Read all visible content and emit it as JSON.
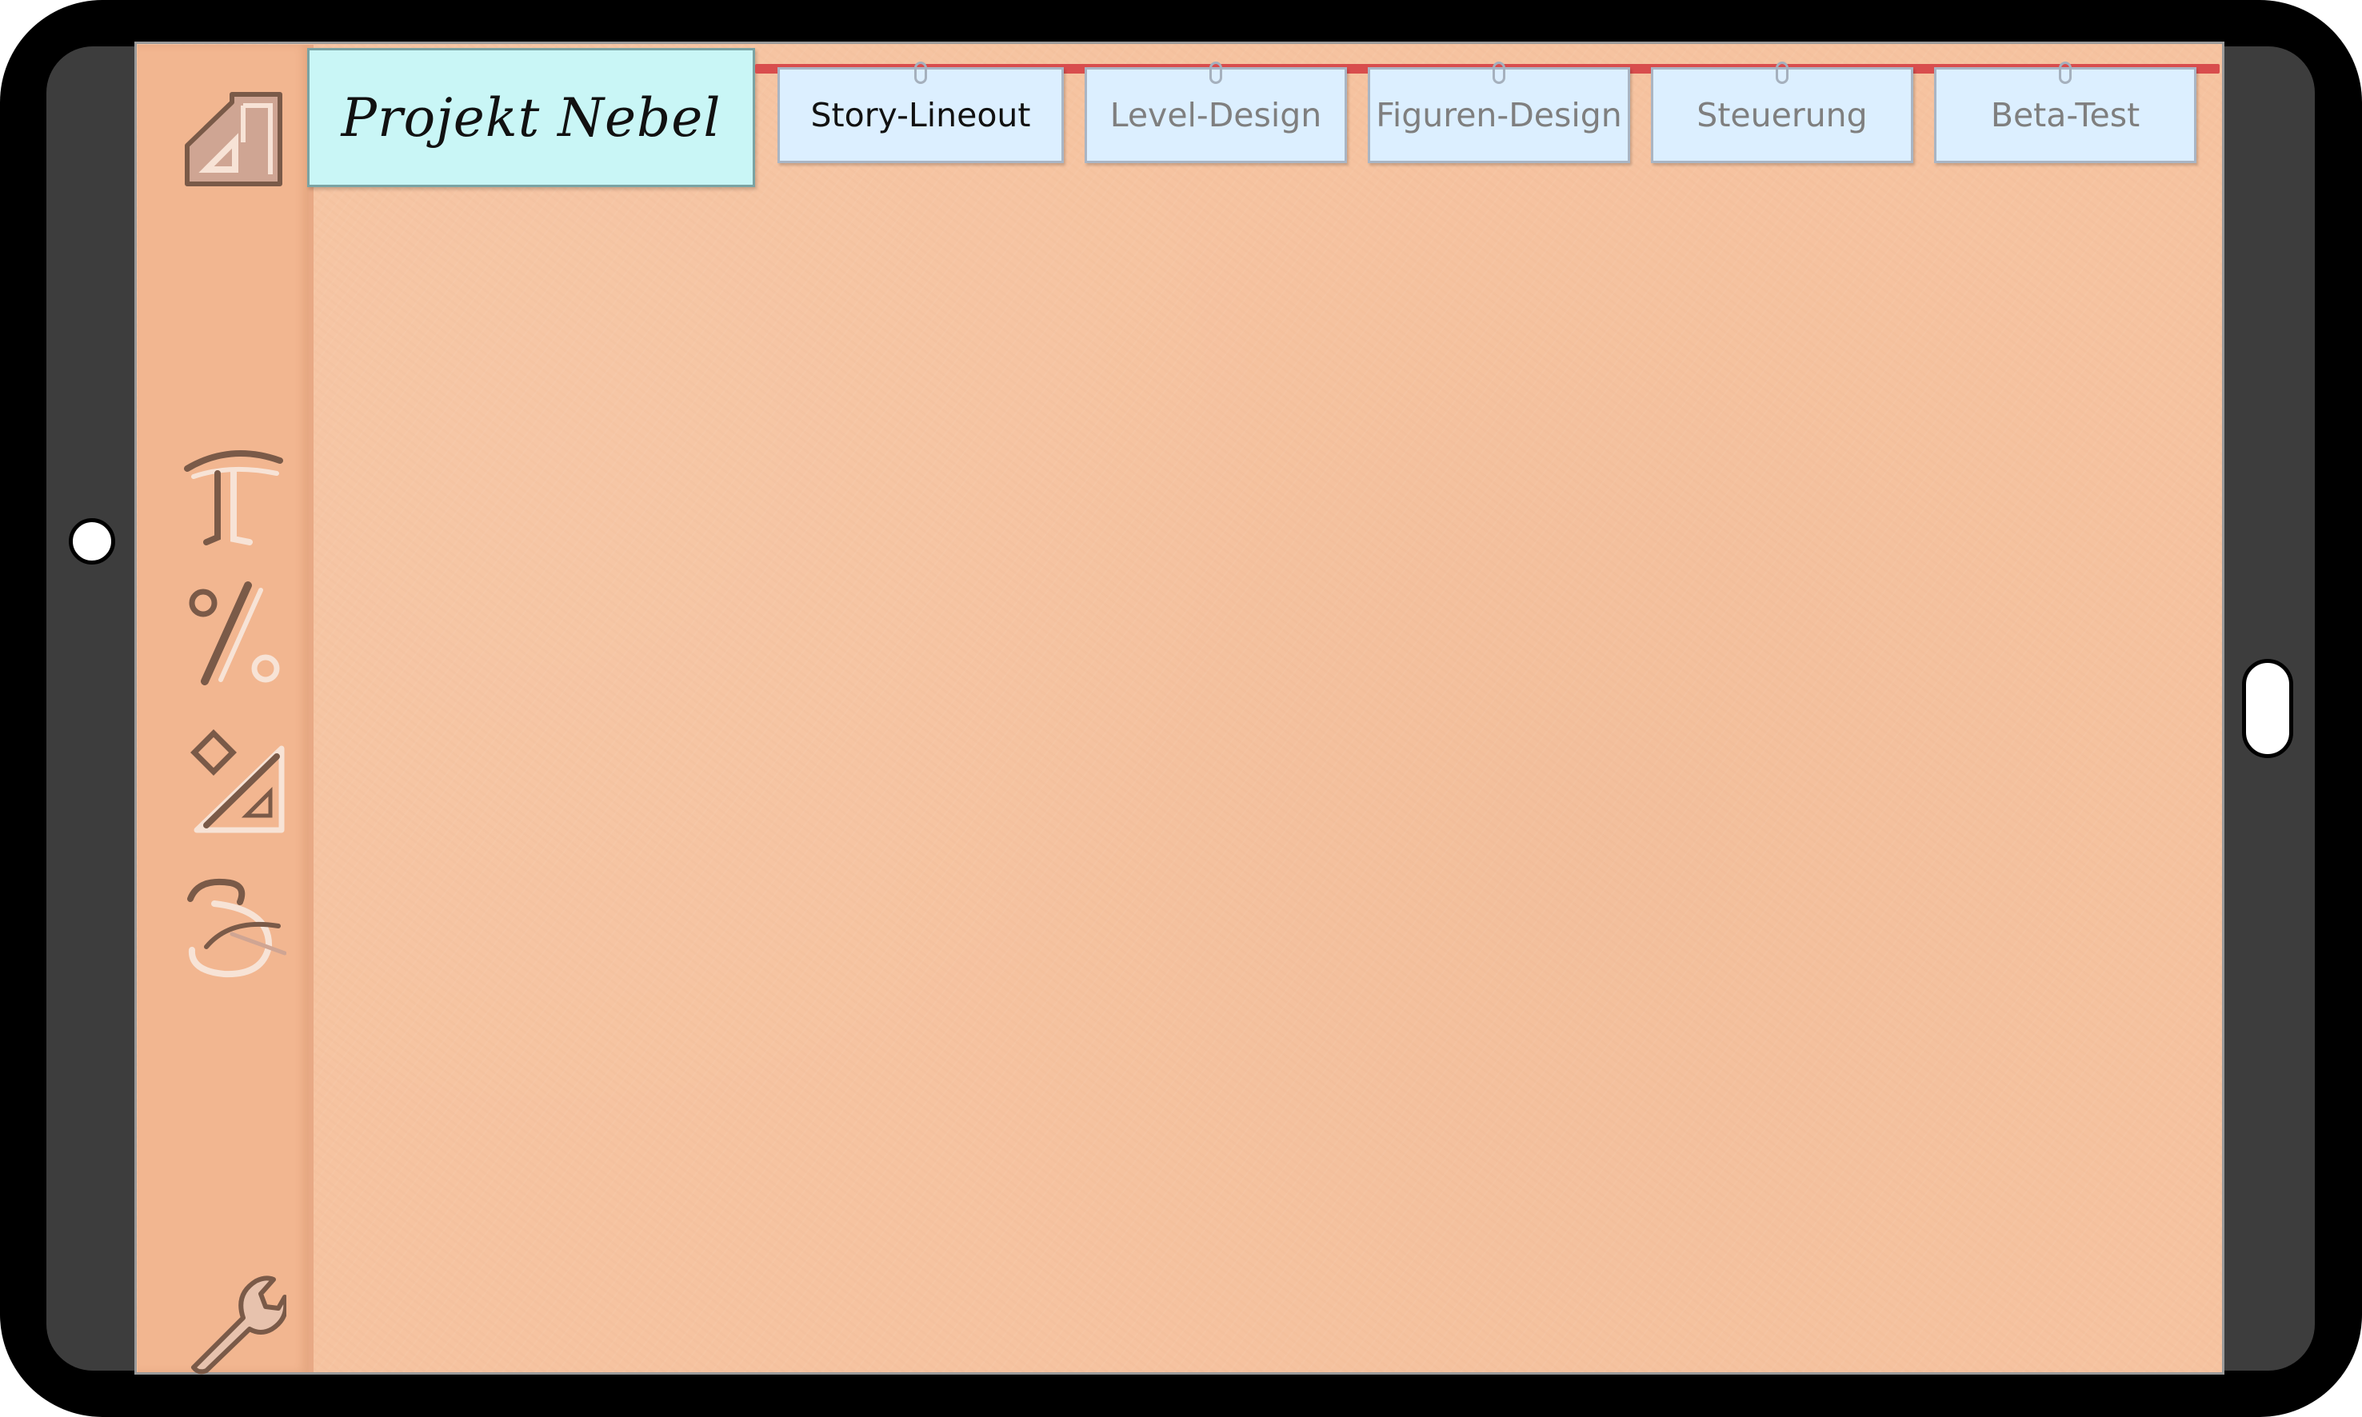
{
  "device": {
    "left_button": "home-button",
    "right_button": "power-button"
  },
  "project": {
    "title": "Projekt Nebel"
  },
  "tabs": [
    {
      "label": "Story-Lineout",
      "active": true
    },
    {
      "label": "Level-Design",
      "active": false
    },
    {
      "label": "Figuren-Design",
      "active": false
    },
    {
      "label": "Steuerung",
      "active": false
    },
    {
      "label": "Beta-Test",
      "active": false
    }
  ],
  "sidebar": {
    "icons": [
      "home-icon",
      "text-icon",
      "percent-icon",
      "geometry-icon",
      "drawing-icon",
      "wrench-icon"
    ]
  },
  "colors": {
    "canvas": "#f6c3a0",
    "sidebar": "#f2b690",
    "title_card": "#c9f6f6",
    "tab": "#dcefff",
    "tab_rail": "#d84d4d",
    "icon": "#7a5a48"
  }
}
